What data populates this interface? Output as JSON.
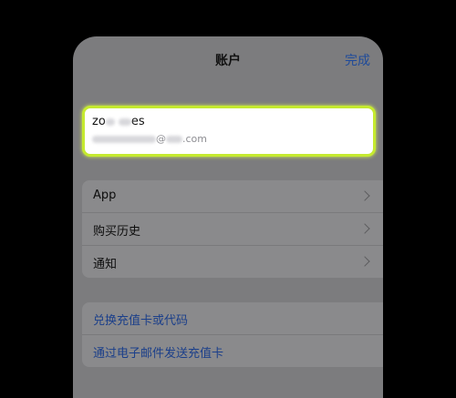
{
  "nav": {
    "title": "账户",
    "done_label": "完成"
  },
  "profile": {
    "name_prefix": "zo",
    "name_suffix": "es",
    "email_domain_at": "@",
    "email_tld": ".com"
  },
  "menu": {
    "items": [
      {
        "label": "App"
      },
      {
        "label": "购买历史"
      },
      {
        "label": "通知"
      }
    ]
  },
  "gift": {
    "items": [
      {
        "label": "兑换充值卡或代码"
      },
      {
        "label": "通过电子邮件发送充值卡"
      }
    ]
  },
  "colors": {
    "accent": "#1e4a9a",
    "highlight": "#c5ea2f",
    "background": "#000000"
  }
}
